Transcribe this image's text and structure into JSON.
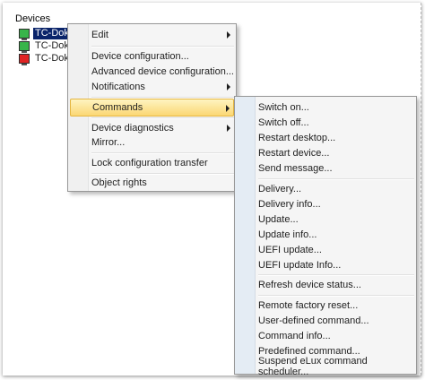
{
  "tree": {
    "header": "Devices",
    "items": [
      {
        "label": "TC-Doku",
        "status": "green"
      },
      {
        "label": "TC-Doku",
        "status": "green"
      },
      {
        "label": "TC-Doku",
        "status": "red"
      }
    ]
  },
  "context_menu": {
    "items": [
      {
        "label": "Edit"
      },
      {
        "label": "Device configuration..."
      },
      {
        "label": "Advanced device configuration..."
      },
      {
        "label": "Notifications"
      },
      {
        "label": "Commands"
      },
      {
        "label": "Device diagnostics"
      },
      {
        "label": "Mirror..."
      },
      {
        "label": "Lock configuration transfer"
      },
      {
        "label": "Object rights"
      }
    ]
  },
  "commands_submenu": {
    "items": [
      {
        "label": "Switch on..."
      },
      {
        "label": "Switch off..."
      },
      {
        "label": "Restart desktop..."
      },
      {
        "label": "Restart device..."
      },
      {
        "label": "Send message..."
      },
      {
        "label": "Delivery..."
      },
      {
        "label": "Delivery info..."
      },
      {
        "label": "Update..."
      },
      {
        "label": "Update info..."
      },
      {
        "label": "UEFI update..."
      },
      {
        "label": "UEFI update Info..."
      },
      {
        "label": "Refresh device status..."
      },
      {
        "label": "Remote factory reset..."
      },
      {
        "label": "User-defined command..."
      },
      {
        "label": "Command info..."
      },
      {
        "label": "Predefined command..."
      },
      {
        "label": "Suspend eLux command scheduler..."
      }
    ]
  },
  "colors": {
    "selection": "#0a246a",
    "highlight_top": "#fef4c1",
    "highlight_bottom": "#fbd774",
    "status_green": "#38b54a",
    "status_red": "#e02424"
  }
}
